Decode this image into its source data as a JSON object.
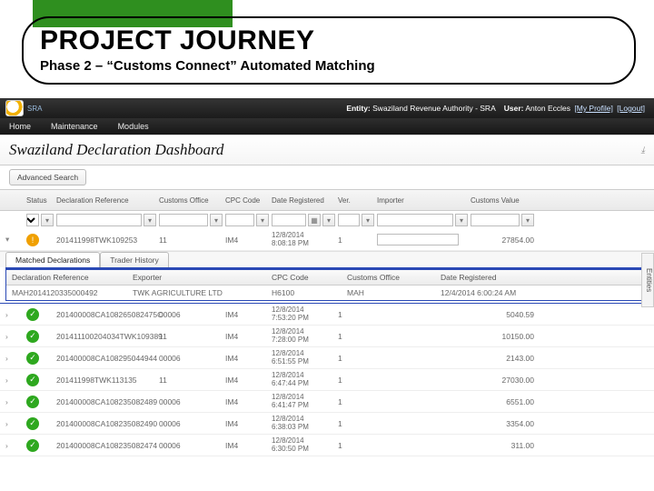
{
  "slide": {
    "title": "PROJECT JOURNEY",
    "subtitle": "Phase 2 – “Customs Connect” Automated Matching"
  },
  "topbar": {
    "brand_abbr": "SRA",
    "entity_label": "Entity:",
    "entity_value": "Swaziland Revenue Authority - SRA",
    "user_label": "User:",
    "user_value": "Anton Eccles",
    "my_profile": "[My Profile]",
    "logout": "[Logout]"
  },
  "menu": {
    "home": "Home",
    "maintenance": "Maintenance",
    "modules": "Modules"
  },
  "dashboard_title": "Swaziland Declaration Dashboard",
  "side_tab": "Entities",
  "toolbar": {
    "advanced_search": "Advanced Search"
  },
  "grid": {
    "headers": {
      "expand": "",
      "status": "Status",
      "declref": "Declaration Reference",
      "office": "Customs Office",
      "cpc": "CPC Code",
      "date": "Date Registered",
      "ver": "Ver.",
      "importer": "Importer",
      "value": "Customs Value"
    },
    "rows": [
      {
        "status": "warn",
        "declref": "201411998TWK109253",
        "office": "11",
        "cpc": "IM4",
        "date": "12/8/2014",
        "time": "8:08:18 PM",
        "ver": "1",
        "importer": "",
        "value": "27854.00"
      },
      {
        "status": "ok",
        "declref": "201400008CA108265082475O",
        "office": "00006",
        "cpc": "IM4",
        "date": "12/8/2014",
        "time": "7:53:20 PM",
        "ver": "1",
        "importer": "",
        "value": "5040.59"
      },
      {
        "status": "ok",
        "declref": "201411100204034TWK109389",
        "office": "11",
        "cpc": "IM4",
        "date": "12/8/2014",
        "time": "7:28:00 PM",
        "ver": "1",
        "importer": "",
        "value": "10150.00"
      },
      {
        "status": "ok",
        "declref": "201400008CA108295044944",
        "office": "00006",
        "cpc": "IM4",
        "date": "12/8/2014",
        "time": "6:51:55 PM",
        "ver": "1",
        "importer": "",
        "value": "2143.00"
      },
      {
        "status": "ok",
        "declref": "201411998TWK113135",
        "office": "11",
        "cpc": "IM4",
        "date": "12/8/2014",
        "time": "6:47:44 PM",
        "ver": "1",
        "importer": "",
        "value": "27030.00"
      },
      {
        "status": "ok",
        "declref": "201400008CA108235082489",
        "office": "00006",
        "cpc": "IM4",
        "date": "12/8/2014",
        "time": "6:41:47 PM",
        "ver": "1",
        "importer": "",
        "value": "6551.00"
      },
      {
        "status": "ok",
        "declref": "201400008CA108235082490",
        "office": "00006",
        "cpc": "IM4",
        "date": "12/8/2014",
        "time": "6:38:03 PM",
        "ver": "1",
        "importer": "",
        "value": "3354.00"
      },
      {
        "status": "ok",
        "declref": "201400008CA108235082474",
        "office": "00006",
        "cpc": "IM4",
        "date": "12/8/2014",
        "time": "6:30:50 PM",
        "ver": "1",
        "importer": "",
        "value": "311.00"
      }
    ]
  },
  "detail": {
    "tabs": {
      "matched": "Matched Declarations",
      "history": "Trader History"
    },
    "headers": {
      "declref": "Declaration Reference",
      "exporter": "Exporter",
      "cpc": "CPC Code",
      "office": "Customs Office",
      "date": "Date Registered"
    },
    "row": {
      "declref": "MAH2014120335000492",
      "exporter": "TWK AGRICULTURE LTD",
      "cpc": "H6100",
      "office": "MAH",
      "date": "12/4/2014 6:00:24 AM"
    }
  }
}
